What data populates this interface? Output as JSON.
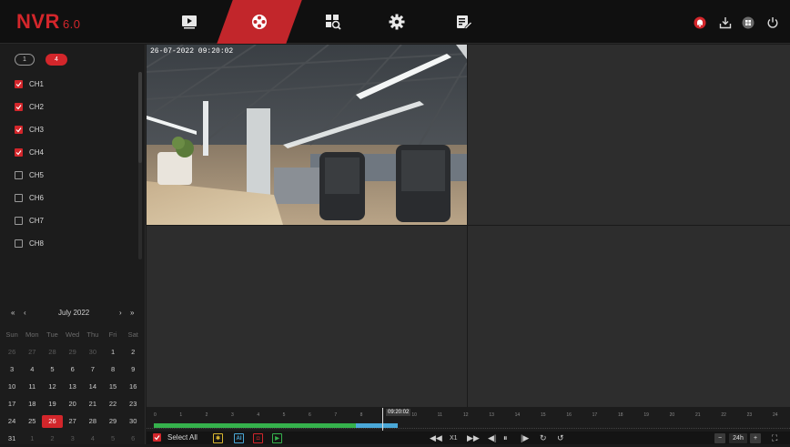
{
  "app": {
    "name": "NVR",
    "version": "6.0"
  },
  "nav": {
    "tabs": [
      {
        "name": "live-view",
        "icon": "play-icon"
      },
      {
        "name": "playback",
        "icon": "reel-icon",
        "active": true
      },
      {
        "name": "search",
        "icon": "grid-search-icon"
      },
      {
        "name": "settings",
        "icon": "gear-icon"
      },
      {
        "name": "maintenance",
        "icon": "edit-list-icon"
      }
    ],
    "right_icons": [
      "alarm-icon",
      "download-icon",
      "layout-icon",
      "power-icon"
    ]
  },
  "sidebar": {
    "pages": [
      "1",
      "4"
    ],
    "active_page": "4",
    "channels": [
      {
        "label": "CH1",
        "checked": true
      },
      {
        "label": "CH2",
        "checked": true
      },
      {
        "label": "CH3",
        "checked": true
      },
      {
        "label": "CH4",
        "checked": true
      },
      {
        "label": "CH5",
        "checked": false
      },
      {
        "label": "CH6",
        "checked": false
      },
      {
        "label": "CH7",
        "checked": false
      },
      {
        "label": "CH8",
        "checked": false
      }
    ]
  },
  "calendar": {
    "month_label": "July 2022",
    "prev_year": "«",
    "prev_month": "‹",
    "next_month": "›",
    "next_year": "»",
    "weekdays": [
      "Sun",
      "Mon",
      "Tue",
      "Wed",
      "Thu",
      "Fri",
      "Sat"
    ],
    "weeks": [
      [
        "26",
        "27",
        "28",
        "29",
        "30",
        "1",
        "2"
      ],
      [
        "3",
        "4",
        "5",
        "6",
        "7",
        "8",
        "9"
      ],
      [
        "10",
        "11",
        "12",
        "13",
        "14",
        "15",
        "16"
      ],
      [
        "17",
        "18",
        "19",
        "20",
        "21",
        "22",
        "23"
      ],
      [
        "24",
        "25",
        "26",
        "27",
        "28",
        "29",
        "30"
      ],
      [
        "31",
        "1",
        "2",
        "3",
        "4",
        "5",
        "6"
      ]
    ],
    "selected": "26"
  },
  "video": {
    "osd": "26-07-2022 09:20:02"
  },
  "timeline": {
    "hours": [
      "0",
      "1",
      "2",
      "3",
      "4",
      "5",
      "6",
      "7",
      "8",
      "9",
      "10",
      "11",
      "12",
      "13",
      "14",
      "15",
      "16",
      "17",
      "18",
      "19",
      "20",
      "21",
      "22",
      "23",
      "24"
    ],
    "cursor_time": "09:20:02"
  },
  "bottom": {
    "select_all": "Select All",
    "type_buttons": [
      {
        "label": "✱",
        "color": "#d8b530"
      },
      {
        "label": "AI",
        "color": "#4aa8d8"
      },
      {
        "label": "◘",
        "color": "#d3262b"
      },
      {
        "label": "▶",
        "color": "#35b14c"
      }
    ],
    "controls": [
      "◀◀",
      "X1",
      "▶▶",
      "◀|",
      "⏸",
      "|▶",
      "↻",
      "↺"
    ],
    "zoom_minus": "−",
    "zoom_value": "24h",
    "zoom_plus": "+",
    "fullscreen": "⛶"
  }
}
